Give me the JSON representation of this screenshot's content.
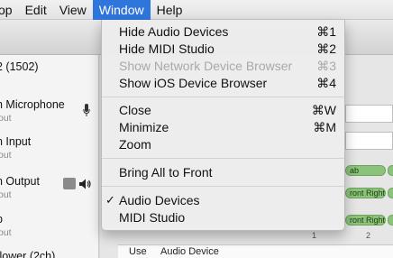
{
  "menubar": {
    "items": [
      {
        "label": "Edit",
        "name": "menu-edit"
      },
      {
        "label": "View",
        "name": "menu-view"
      },
      {
        "label": "Window",
        "name": "menu-window"
      },
      {
        "label": "Help",
        "name": "menu-help"
      }
    ],
    "partial": "op"
  },
  "window_menu": {
    "hide_audio": {
      "label": "Hide Audio Devices",
      "shortcut": "⌘1"
    },
    "hide_midi": {
      "label": "Hide MIDI Studio",
      "shortcut": "⌘2"
    },
    "show_network": {
      "label": "Show Network Device Browser",
      "shortcut": "⌘3"
    },
    "show_ios": {
      "label": "Show iOS Device Browser",
      "shortcut": "⌘4"
    },
    "close": {
      "label": "Close",
      "shortcut": "⌘W"
    },
    "minimize": {
      "label": "Minimize",
      "shortcut": "⌘M"
    },
    "zoom": {
      "label": "Zoom"
    },
    "bring_all": {
      "label": "Bring All to Front"
    },
    "audio_devices": {
      "label": "Audio Devices",
      "check": "✓"
    },
    "midi_studio": {
      "label": "MIDI Studio"
    }
  },
  "sidebar": {
    "devices": [
      {
        "name": "2 (1502)",
        "sub": ""
      },
      {
        "name": "n Microphone",
        "sub": "out"
      },
      {
        "name": "n Input",
        "sub": "out"
      },
      {
        "name": "n Output",
        "sub": "out"
      },
      {
        "name": "b",
        "sub": "out"
      },
      {
        "name": "flower (2ch)",
        "sub": ""
      }
    ]
  },
  "content": {
    "pills": [
      "ab",
      "ront Right",
      "ront Right"
    ],
    "grid_numbers": [
      "1",
      "2"
    ],
    "table_headers": [
      "Use",
      "Audio Device"
    ]
  },
  "colors": {
    "accent": "#2f76dc",
    "pill_green": "#8bc37a"
  }
}
